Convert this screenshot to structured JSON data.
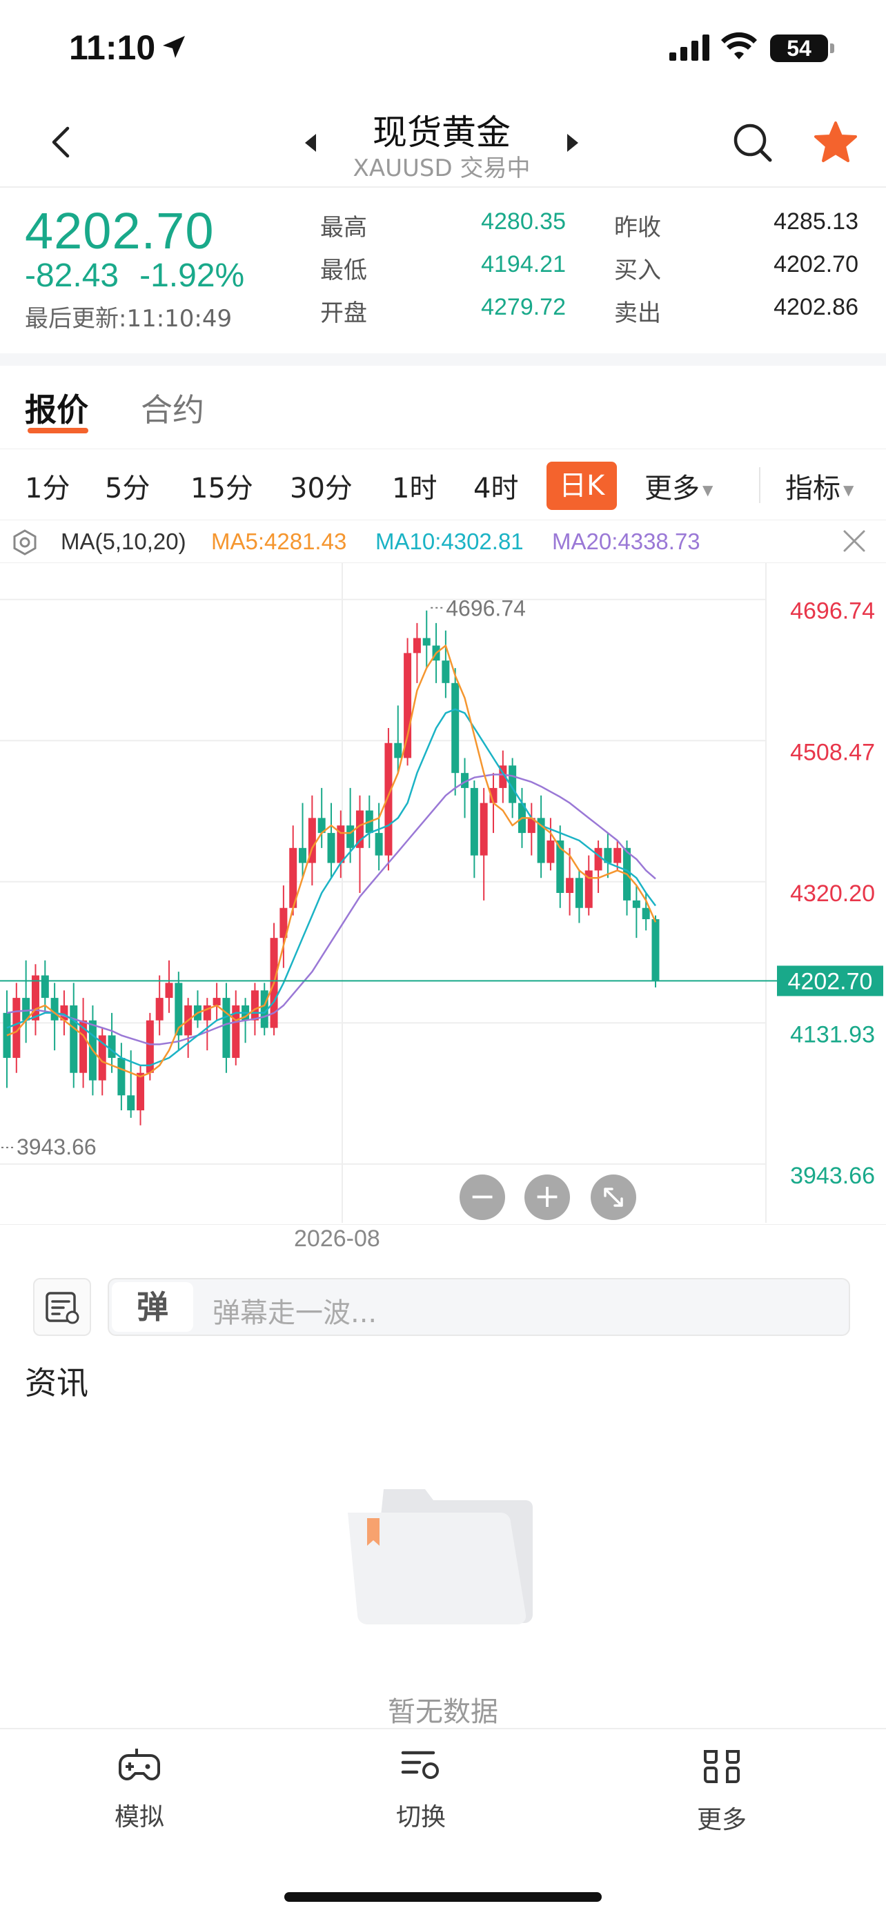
{
  "status_bar": {
    "time": "11:10",
    "battery": "54"
  },
  "nav": {
    "title": "现货黄金",
    "subtitle": "XAUUSD 交易中"
  },
  "quote": {
    "price": "4202.70",
    "change": "-82.43",
    "change_pct": "-1.92%",
    "updated": "最后更新:11:10:49",
    "stats": [
      {
        "label": "最高",
        "value": "4280.35",
        "color": "#19a98a"
      },
      {
        "label": "最低",
        "value": "4194.21",
        "color": "#19a98a"
      },
      {
        "label": "开盘",
        "value": "4279.72",
        "color": "#19a98a"
      },
      {
        "label": "昨收",
        "value": "4285.13",
        "color": "#222222"
      },
      {
        "label": "买入",
        "value": "4202.70",
        "color": "#222222"
      },
      {
        "label": "卖出",
        "value": "4202.86",
        "color": "#222222"
      }
    ]
  },
  "tabs": [
    {
      "label": "报价"
    },
    {
      "label": "合约"
    }
  ],
  "periods": [
    {
      "label": "1分"
    },
    {
      "label": "5分"
    },
    {
      "label": "15分"
    },
    {
      "label": "30分"
    },
    {
      "label": "1时"
    },
    {
      "label": "4时"
    },
    {
      "label": "日K"
    },
    {
      "label": "更多"
    },
    {
      "label": "指标"
    }
  ],
  "ma": {
    "label": "MA(5,10,20)",
    "ma5": "MA5:4281.43",
    "ma10": "MA10:4302.81",
    "ma20": "MA20:4338.73"
  },
  "chart_data": {
    "type": "candlestick",
    "y_ticks": [
      "4696.74",
      "4508.47",
      "4320.20",
      "4131.93",
      "3943.66"
    ],
    "y_tick_colors": [
      "#e8364a",
      "#e8364a",
      "#e8364a",
      "#19a98a",
      "#19a98a"
    ],
    "current_price": "4202.70",
    "high_label": "4696.74",
    "low_label": "3943.66",
    "x_label": "2026-08",
    "ylim": [
      3880,
      4760
    ],
    "colors": {
      "up": "#e8364a",
      "down": "#19a98a",
      "ma5": "#f5962f",
      "ma10": "#1bb3c5",
      "ma20": "#9a78d6"
    },
    "candles": [
      [
        4160,
        4190,
        4060,
        4100
      ],
      [
        4100,
        4200,
        4080,
        4180
      ],
      [
        4180,
        4230,
        4120,
        4150
      ],
      [
        4150,
        4225,
        4130,
        4210
      ],
      [
        4210,
        4230,
        4160,
        4180
      ],
      [
        4180,
        4200,
        4110,
        4150
      ],
      [
        4150,
        4190,
        4130,
        4170
      ],
      [
        4170,
        4200,
        4060,
        4080
      ],
      [
        4080,
        4180,
        4060,
        4150
      ],
      [
        4150,
        4170,
        4050,
        4070
      ],
      [
        4070,
        4140,
        4050,
        4130
      ],
      [
        4130,
        4160,
        4080,
        4100
      ],
      [
        4100,
        4120,
        4030,
        4050
      ],
      [
        4050,
        4110,
        4020,
        4030
      ],
      [
        4030,
        4090,
        4010,
        4080
      ],
      [
        4080,
        4160,
        4070,
        4150
      ],
      [
        4150,
        4210,
        4130,
        4180
      ],
      [
        4180,
        4230,
        4160,
        4200
      ],
      [
        4200,
        4215,
        4110,
        4130
      ],
      [
        4130,
        4180,
        4100,
        4170
      ],
      [
        4170,
        4190,
        4140,
        4150
      ],
      [
        4150,
        4180,
        4110,
        4170
      ],
      [
        4170,
        4200,
        4150,
        4180
      ],
      [
        4180,
        4200,
        4080,
        4100
      ],
      [
        4100,
        4190,
        4090,
        4170
      ],
      [
        4170,
        4180,
        4120,
        4150
      ],
      [
        4150,
        4200,
        4130,
        4190
      ],
      [
        4190,
        4200,
        4130,
        4140
      ],
      [
        4140,
        4280,
        4130,
        4260
      ],
      [
        4260,
        4330,
        4220,
        4300
      ],
      [
        4300,
        4410,
        4290,
        4380
      ],
      [
        4380,
        4440,
        4340,
        4360
      ],
      [
        4360,
        4450,
        4330,
        4420
      ],
      [
        4420,
        4460,
        4380,
        4400
      ],
      [
        4400,
        4440,
        4340,
        4360
      ],
      [
        4360,
        4430,
        4340,
        4410
      ],
      [
        4410,
        4460,
        4360,
        4380
      ],
      [
        4380,
        4450,
        4320,
        4430
      ],
      [
        4430,
        4450,
        4380,
        4400
      ],
      [
        4400,
        4440,
        4350,
        4370
      ],
      [
        4370,
        4540,
        4350,
        4520
      ],
      [
        4520,
        4570,
        4480,
        4500
      ],
      [
        4500,
        4660,
        4490,
        4640
      ],
      [
        4640,
        4680,
        4600,
        4660
      ],
      [
        4660,
        4696.74,
        4620,
        4650
      ],
      [
        4650,
        4680,
        4600,
        4630
      ],
      [
        4630,
        4670,
        4580,
        4600
      ],
      [
        4600,
        4620,
        4450,
        4480
      ],
      [
        4480,
        4500,
        4420,
        4460
      ],
      [
        4460,
        4470,
        4340,
        4370
      ],
      [
        4370,
        4460,
        4310,
        4440
      ],
      [
        4440,
        4480,
        4400,
        4460
      ],
      [
        4460,
        4510,
        4440,
        4490
      ],
      [
        4490,
        4500,
        4420,
        4440
      ],
      [
        4440,
        4460,
        4380,
        4400
      ],
      [
        4400,
        4440,
        4370,
        4420
      ],
      [
        4420,
        4450,
        4340,
        4360
      ],
      [
        4360,
        4420,
        4350,
        4390
      ],
      [
        4390,
        4410,
        4300,
        4320
      ],
      [
        4320,
        4380,
        4290,
        4340
      ],
      [
        4340,
        4350,
        4280,
        4300
      ],
      [
        4300,
        4370,
        4290,
        4350
      ],
      [
        4350,
        4390,
        4320,
        4380
      ],
      [
        4380,
        4400,
        4340,
        4360
      ],
      [
        4360,
        4390,
        4350,
        4380
      ],
      [
        4380,
        4390,
        4290,
        4310
      ],
      [
        4310,
        4330,
        4260,
        4300
      ],
      [
        4300,
        4320,
        4270,
        4285
      ],
      [
        4285,
        4290,
        4194,
        4202.7
      ]
    ],
    "ma5_series": [
      4130,
      4135,
      4150,
      4165,
      4170,
      4160,
      4150,
      4140,
      4130,
      4110,
      4095,
      4090,
      4085,
      4080,
      4075,
      4080,
      4090,
      4110,
      4140,
      4150,
      4160,
      4165,
      4170,
      4160,
      4150,
      4155,
      4165,
      4170,
      4200,
      4250,
      4300,
      4340,
      4380,
      4400,
      4410,
      4400,
      4400,
      4410,
      4415,
      4420,
      4450,
      4480,
      4530,
      4590,
      4620,
      4640,
      4650,
      4610,
      4580,
      4530,
      4480,
      4440,
      4430,
      4410,
      4420,
      4420,
      4410,
      4400,
      4380,
      4370,
      4350,
      4340,
      4340,
      4345,
      4350,
      4345,
      4330,
      4310,
      4281
    ],
    "ma10_series": [
      4140,
      4145,
      4150,
      4155,
      4160,
      4160,
      4158,
      4150,
      4140,
      4130,
      4120,
      4110,
      4100,
      4095,
      4090,
      4090,
      4095,
      4100,
      4110,
      4120,
      4130,
      4140,
      4150,
      4155,
      4160,
      4160,
      4160,
      4160,
      4175,
      4200,
      4230,
      4260,
      4290,
      4320,
      4340,
      4360,
      4375,
      4390,
      4400,
      4405,
      4410,
      4420,
      4440,
      4480,
      4510,
      4540,
      4560,
      4565,
      4560,
      4540,
      4520,
      4500,
      4480,
      4460,
      4440,
      4420,
      4410,
      4405,
      4400,
      4395,
      4390,
      4380,
      4370,
      4360,
      4355,
      4350,
      4340,
      4320,
      4303
    ],
    "ma20_series": [
      4160,
      4162,
      4163,
      4164,
      4162,
      4160,
      4156,
      4152,
      4148,
      4144,
      4140,
      4136,
      4130,
      4126,
      4122,
      4118,
      4118,
      4120,
      4122,
      4126,
      4130,
      4135,
      4140,
      4145,
      4148,
      4150,
      4152,
      4155,
      4160,
      4170,
      4185,
      4200,
      4215,
      4235,
      4255,
      4275,
      4295,
      4315,
      4330,
      4345,
      4360,
      4375,
      4390,
      4405,
      4420,
      4435,
      4450,
      4460,
      4468,
      4474,
      4476,
      4478,
      4478,
      4476,
      4472,
      4468,
      4462,
      4455,
      4448,
      4440,
      4430,
      4420,
      4410,
      4400,
      4390,
      4375,
      4365,
      4350,
      4339
    ]
  },
  "zoom": {
    "minus": "−",
    "plus": "+"
  },
  "danmaku": {
    "badge": "弹",
    "placeholder": "弹幕走一波..."
  },
  "news": {
    "title": "资讯",
    "empty": "暂无数据"
  },
  "tabbar": [
    {
      "label": "模拟"
    },
    {
      "label": "切换"
    },
    {
      "label": "更多"
    }
  ],
  "icons": [
    "location-arrow-icon",
    "signal-icon",
    "wifi-icon",
    "battery-icon",
    "back-icon",
    "prev-icon",
    "next-icon",
    "search-icon",
    "star-icon",
    "settings-hex-icon",
    "close-icon",
    "collapse-icon",
    "danmaku-settings-icon",
    "folder-icon",
    "gamepad-icon",
    "switch-icon",
    "grid-icon"
  ]
}
